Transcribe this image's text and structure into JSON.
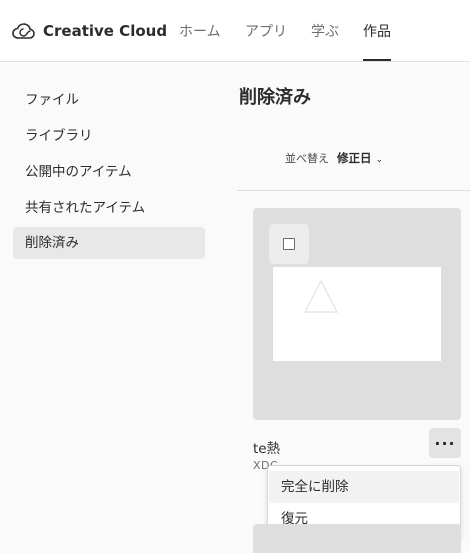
{
  "header": {
    "brand": "Creative Cloud",
    "nav": [
      {
        "label": "ホーム",
        "active": false
      },
      {
        "label": "アプリ",
        "active": false
      },
      {
        "label": "学ぶ",
        "active": false
      },
      {
        "label": "作品",
        "active": true
      }
    ]
  },
  "sidebar": {
    "items": [
      {
        "label": "ファイル",
        "selected": false
      },
      {
        "label": "ライブラリ",
        "selected": false
      },
      {
        "label": "公開中のアイテム",
        "selected": false
      },
      {
        "label": "共有されたアイテム",
        "selected": false
      },
      {
        "label": "削除済み",
        "selected": true
      }
    ]
  },
  "main": {
    "title": "削除済み",
    "sort": {
      "label": "並べ替え",
      "value": "修正日"
    },
    "card": {
      "name": "te熱",
      "type": "XDC"
    },
    "context_menu": {
      "items": [
        {
          "label": "完全に削除"
        },
        {
          "label": "復元"
        }
      ]
    }
  },
  "colors": {
    "background": "#fafafa",
    "thumbnail": "#dedede",
    "selected": "#e8e8e8"
  },
  "icons": [
    "creative-cloud-logo-icon",
    "chevron-down-icon",
    "more-icon",
    "checkbox-icon",
    "xd-triangle-icon"
  ]
}
